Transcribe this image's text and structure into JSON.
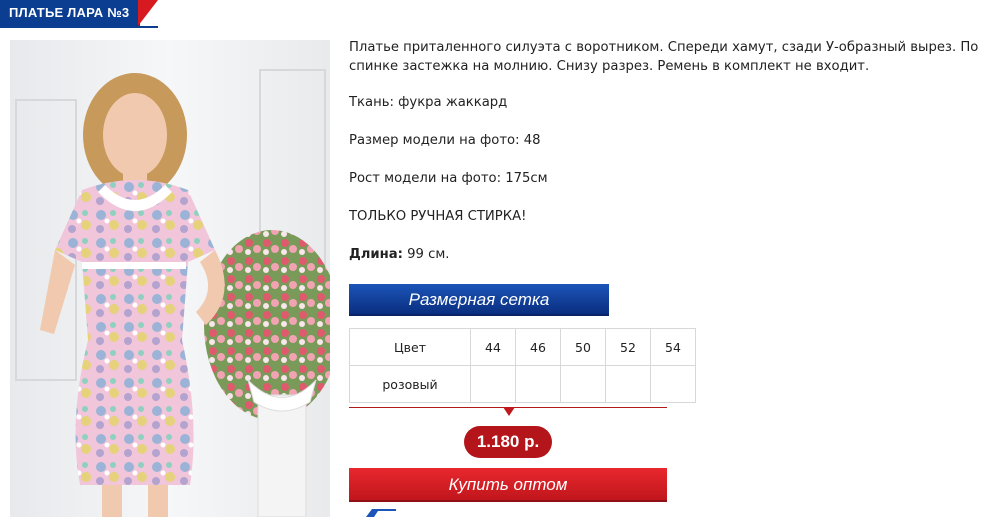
{
  "product": {
    "title": "ПЛАТЬЕ ЛАРА №3",
    "description_1": "Платье приталенного силуэта с воротником. Спереди хамут, сзади У-образный вырез. По спинке застежка на молнию. Снизу разрез. Ремень в комплект не входит.",
    "fabric": "Ткань: фукра жаккард",
    "model_size": "Размер модели на фото: 48",
    "model_height": "Рост модели на фото: 175см",
    "wash_note": "ТОЛЬКО РУЧНАЯ СТИРКА!",
    "length_label": "Длина:",
    "length_value": "99 см."
  },
  "size_chart": {
    "button_label": "Размерная сетка",
    "header": [
      "Цвет",
      "44",
      "46",
      "50",
      "52",
      "54"
    ],
    "rows": [
      [
        "розовый",
        "",
        "",
        "",
        "",
        ""
      ]
    ]
  },
  "price": "1.180 р.",
  "buy_label": "Купить оптом",
  "colors": {
    "brand_blue": "#0b3d91",
    "brand_red": "#d71920",
    "price_red": "#b3151b"
  },
  "icons": {
    "photo": "product-photo"
  }
}
